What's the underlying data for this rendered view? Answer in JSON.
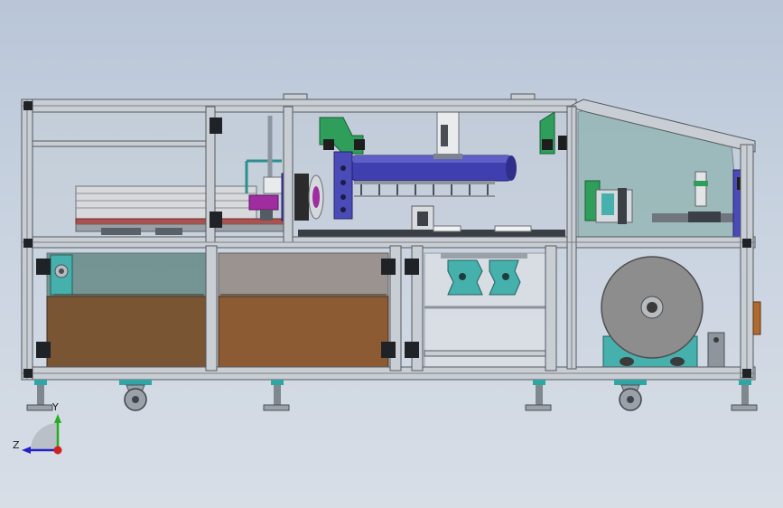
{
  "view": {
    "type": "CAD model front view",
    "background_top": "#b9c6d8",
    "background_bottom": "#d8dee6"
  },
  "colors": {
    "frame": "#c9ced4",
    "frame_edge": "#55595f",
    "glass": "#8fb3b0",
    "brown_panel": "#7a5533",
    "green_part": "#2e9e5a",
    "teal_part": "#45b0ad",
    "blue_cylinder": "#3f3fb0",
    "purple_part": "#a02da0",
    "roll_gray": "#8d8d8d"
  },
  "axes_triad": {
    "y_label": "Y",
    "z_label": "Z",
    "y_color": "#22b022",
    "z_color": "#2222c8",
    "x_color": "#d02020"
  },
  "icons": [
    "caster-wheel-icon",
    "leveling-foot-icon",
    "axis-triad-icon"
  ]
}
